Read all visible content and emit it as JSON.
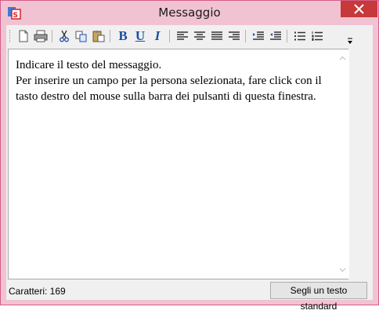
{
  "window": {
    "title": "Messaggio"
  },
  "toolbar": {
    "buttons": [
      {
        "name": "new-document-icon"
      },
      {
        "name": "print-icon"
      },
      {
        "name": "cut-icon"
      },
      {
        "name": "copy-icon"
      },
      {
        "name": "paste-icon"
      },
      {
        "name": "bold-icon",
        "glyph": "B"
      },
      {
        "name": "underline-icon",
        "glyph": "U"
      },
      {
        "name": "italic-icon",
        "glyph": "I"
      },
      {
        "name": "align-left-icon"
      },
      {
        "name": "align-center-icon"
      },
      {
        "name": "align-justify-icon"
      },
      {
        "name": "align-right-icon"
      },
      {
        "name": "indent-increase-icon"
      },
      {
        "name": "indent-decrease-icon"
      },
      {
        "name": "bullet-list-icon"
      },
      {
        "name": "numbered-list-icon"
      }
    ]
  },
  "editor": {
    "line1": "Indicare il testo del messaggio.",
    "line2": "Per inserire un campo per la persona selezionata, fare click con il tasto destro del mouse sulla barra dei pulsanti di questa finestra."
  },
  "status": {
    "char_count": "Caratteri: 169",
    "standard_text_button": "Segli un testo standard"
  },
  "colors": {
    "frame": "#f1c3d2",
    "close": "#c7383b"
  }
}
